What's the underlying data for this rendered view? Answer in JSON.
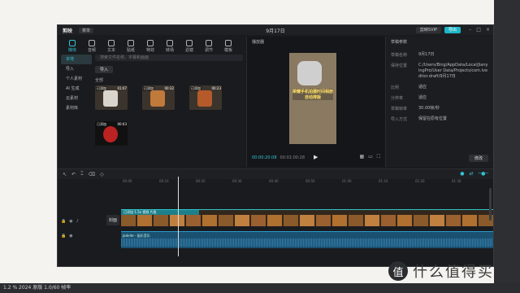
{
  "app": {
    "logo": "剪映",
    "menu_label": "菜单",
    "title": "9月17日",
    "buttons": {
      "pro": "剪映SVIP",
      "export": "导出"
    }
  },
  "toolbar": {
    "tools": [
      {
        "label": "媒体",
        "icon": "media-icon",
        "active": true
      },
      {
        "label": "音频",
        "icon": "audio-icon"
      },
      {
        "label": "文本",
        "icon": "text-icon"
      },
      {
        "label": "贴纸",
        "icon": "sticker-icon"
      },
      {
        "label": "特效",
        "icon": "effect-icon"
      },
      {
        "label": "转场",
        "icon": "transition-icon"
      },
      {
        "label": "滤镜",
        "icon": "filter-icon"
      },
      {
        "label": "调节",
        "icon": "adjust-icon"
      },
      {
        "label": "模板",
        "icon": "template-icon"
      }
    ]
  },
  "left_nav": {
    "items": [
      "本地",
      "导入",
      "个人素材",
      "AI 生成",
      "云素材",
      "素材库"
    ]
  },
  "media": {
    "search_placeholder": "搜索文件名称、字幕和画面",
    "import_label": "导入",
    "section_label": "全部",
    "clips": [
      {
        "tag": "已添加",
        "duration": "01:07"
      },
      {
        "tag": "已添加",
        "duration": "00:32"
      },
      {
        "tag": "已添加",
        "duration": "00:23"
      },
      {
        "tag": "已添加",
        "duration": "00:03"
      }
    ]
  },
  "player": {
    "title": "播放器",
    "caption": "荣耀手机拍摄时间相册自动排版",
    "time_current": "00:00:20:08",
    "time_total": "00:01:00:28"
  },
  "properties": {
    "title": "草稿参数",
    "rows": [
      {
        "k": "草稿名称",
        "v": "9月17日"
      },
      {
        "k": "保存位置",
        "v": "C:/Users/Bing/AppData/Local/JianyingPro/User Data/Projects/com.lveditor.draft/9月17日"
      },
      {
        "k": "比例",
        "v": "适应"
      },
      {
        "k": "分辨率",
        "v": "适应"
      },
      {
        "k": "草稿帧率",
        "v": "30.00帧/秒"
      },
      {
        "k": "导入方式",
        "v": "保留在原有位置"
      }
    ],
    "edit_label": "修改"
  },
  "timeline": {
    "ruler": [
      "00:00",
      "00:10",
      "00:20",
      "00:30",
      "00:40",
      "00:50",
      "01:00",
      "01:10",
      "01:20",
      "01:30"
    ],
    "cover_label": "封面",
    "video_clip_label": "已添加 1.5x  视频 片段",
    "audio_clip_label": "Jadeite - 配乐音乐"
  },
  "statusbar": {
    "text": "1.2 %  2024 原版 1.0/60 帧率"
  },
  "watermark": {
    "text": "什么值得买",
    "logo": "值"
  }
}
